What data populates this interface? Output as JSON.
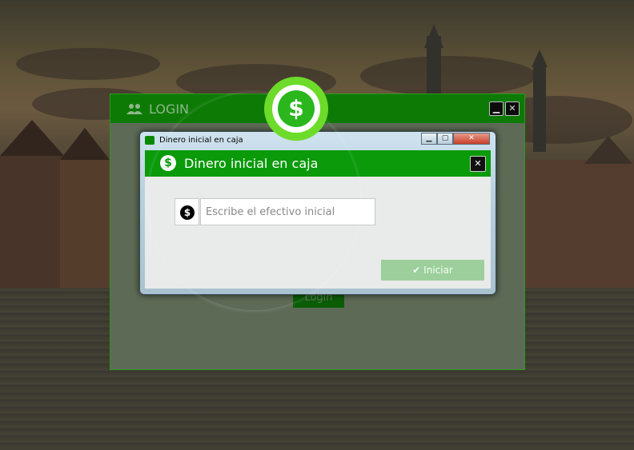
{
  "login_window": {
    "title": "LOGIN",
    "icon": "users-icon",
    "login_button": "Login",
    "minimize_glyph": "▁",
    "close_glyph": "✕"
  },
  "dinero_window": {
    "frame_title": "Dinero inicial en caja",
    "header_title": "Dinero inicial en caja",
    "header_icon_glyph": "$",
    "close_glyph": "✕",
    "money_icon_glyph": "$",
    "amount_placeholder": "Escribe el efectivo inicial",
    "amount_value": "",
    "start_button": "Iniciar",
    "start_icon_glyph": "✔"
  },
  "spotlight_badge_glyph": "$",
  "colors": {
    "header_green": "#0a9a0a",
    "login_green": "#0d7a06",
    "badge_green": "#6ddb2a",
    "button_disabled": "#9ccf9c"
  }
}
